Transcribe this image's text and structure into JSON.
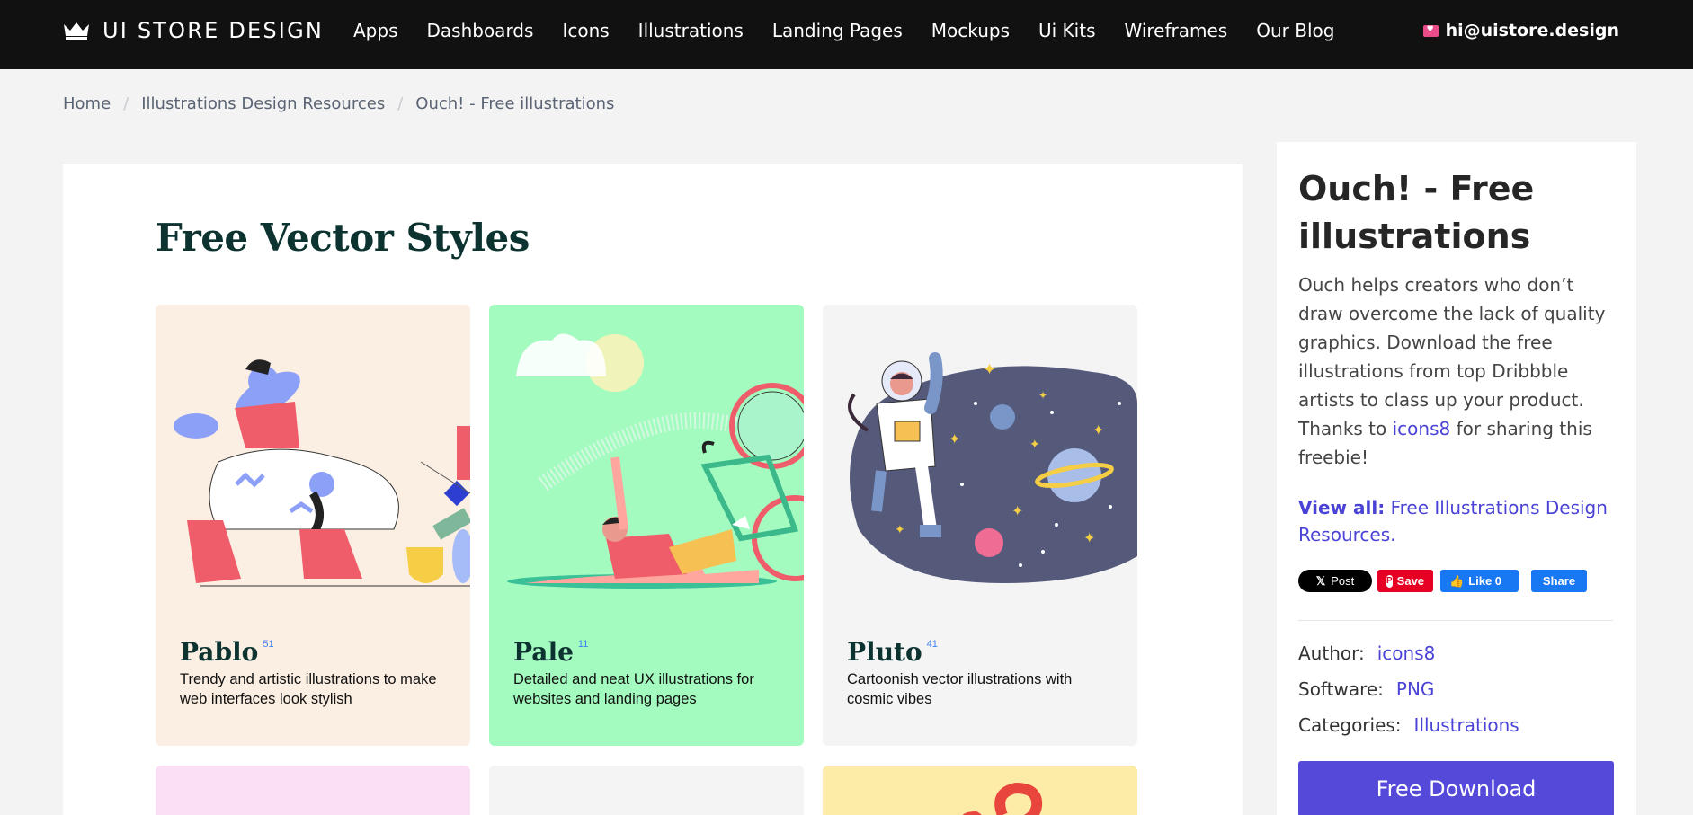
{
  "header": {
    "brand": "UI STORE DESIGN",
    "nav": [
      "Apps",
      "Dashboards",
      "Icons",
      "Illustrations",
      "Landing Pages",
      "Mockups",
      "Ui Kits",
      "Wireframes",
      "Our Blog"
    ],
    "email": "hi@uistore.design"
  },
  "breadcrumb": [
    "Home",
    "Illustrations Design Resources",
    "Ouch! - Free illustrations"
  ],
  "main": {
    "heading": "Free Vector Styles",
    "cards": [
      {
        "name": "Pablo",
        "count": "51",
        "desc": "Trendy and artistic illustrations to make web interfaces look stylish",
        "bg": "#fbeee2"
      },
      {
        "name": "Pale",
        "count": "11",
        "desc": "Detailed and neat UX illustrations for websites and landing pages",
        "bg": "#a3fbc0"
      },
      {
        "name": "Pluto",
        "count": "41",
        "desc": "Cartoonish vector illustrations with cosmic vibes",
        "bg": "#f4f4f4"
      }
    ]
  },
  "sidebar": {
    "title": "Ouch! - Free illustrations",
    "desc_before": "Ouch helps creators who don’t draw overcome the lack of quality graphics. Download the free illustrations from top Dribbble artists to class up your product. Thanks to ",
    "desc_link": "icons8",
    "desc_after": " for sharing this freebie!",
    "viewall_label": "View all:",
    "viewall_link": "Free Illustrations Design Resources.",
    "social": {
      "x": "Post",
      "pinterest": "Save",
      "fb_like": "Like 0",
      "fb_share": "Share"
    },
    "author_label": "Author:",
    "author": "icons8",
    "software_label": "Software:",
    "software": "PNG",
    "categories_label": "Categories:",
    "categories": "Illustrations",
    "download": "Free Download"
  },
  "colors": {
    "accent": "#4a43d6",
    "button": "#5549d9",
    "topbar": "#111111"
  }
}
